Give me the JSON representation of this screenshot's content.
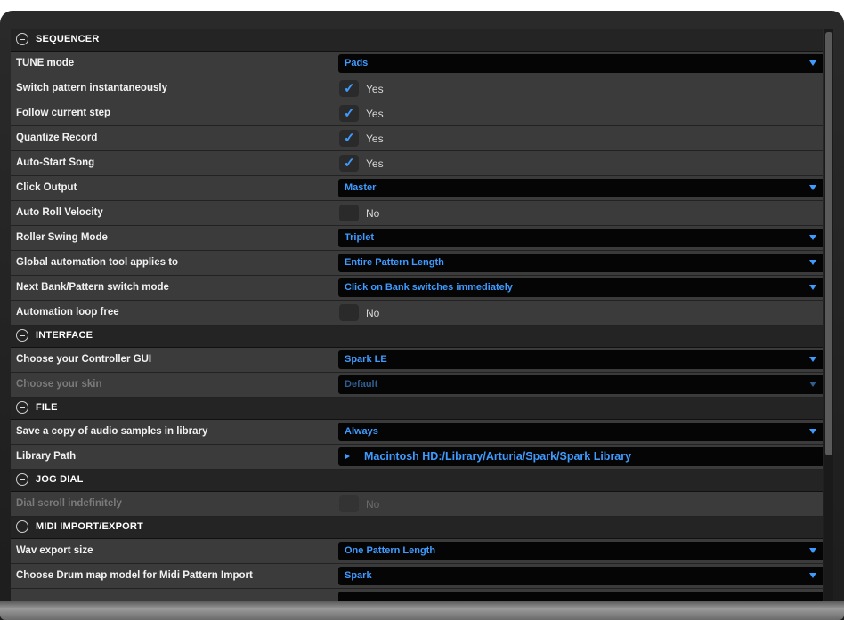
{
  "sections": {
    "sequencer": "SEQUENCER",
    "interface": "INTERFACE",
    "file": "FILE",
    "jog_dial": "JOG DIAL",
    "midi": "MIDI IMPORT/EXPORT"
  },
  "rows": {
    "tune_mode": {
      "label": "TUNE mode",
      "value": "Pads"
    },
    "switch_pattern": {
      "label": "Switch pattern instantaneously",
      "value": "Yes"
    },
    "follow_step": {
      "label": "Follow current step",
      "value": "Yes"
    },
    "quantize_record": {
      "label": "Quantize Record",
      "value": "Yes"
    },
    "auto_start": {
      "label": "Auto-Start Song",
      "value": "Yes"
    },
    "click_output": {
      "label": "Click Output",
      "value": "Master"
    },
    "auto_roll": {
      "label": "Auto Roll Velocity",
      "value": "No"
    },
    "roller_swing": {
      "label": "Roller Swing Mode",
      "value": "Triplet"
    },
    "global_auto": {
      "label": "Global automation tool applies to",
      "value": "Entire Pattern Length"
    },
    "next_bank": {
      "label": "Next Bank/Pattern switch mode",
      "value": "Click on Bank switches immediately"
    },
    "auto_loop": {
      "label": "Automation loop free",
      "value": "No"
    },
    "controller_gui": {
      "label": "Choose your Controller GUI",
      "value": "Spark LE"
    },
    "skin": {
      "label": "Choose your skin",
      "value": "Default"
    },
    "save_copy": {
      "label": "Save a copy of audio samples in library",
      "value": "Always"
    },
    "library_path": {
      "label": "Library Path",
      "value": "Macintosh HD:/Library/Arturia/Spark/Spark Library"
    },
    "dial_scroll": {
      "label": "Dial scroll indefinitely",
      "value": "No"
    },
    "wav_export": {
      "label": "Wav export size",
      "value": "One Pattern Length"
    },
    "drum_map": {
      "label": "Choose Drum map model for Midi Pattern Import",
      "value": "Spark"
    }
  },
  "colors": {
    "accent": "#3f9bff",
    "panel": "#3b3b3b",
    "header": "#242424"
  },
  "icons": [
    "collapse-icon",
    "dropdown-arrow-icon",
    "checkmark-icon",
    "play-arrow-icon"
  ]
}
